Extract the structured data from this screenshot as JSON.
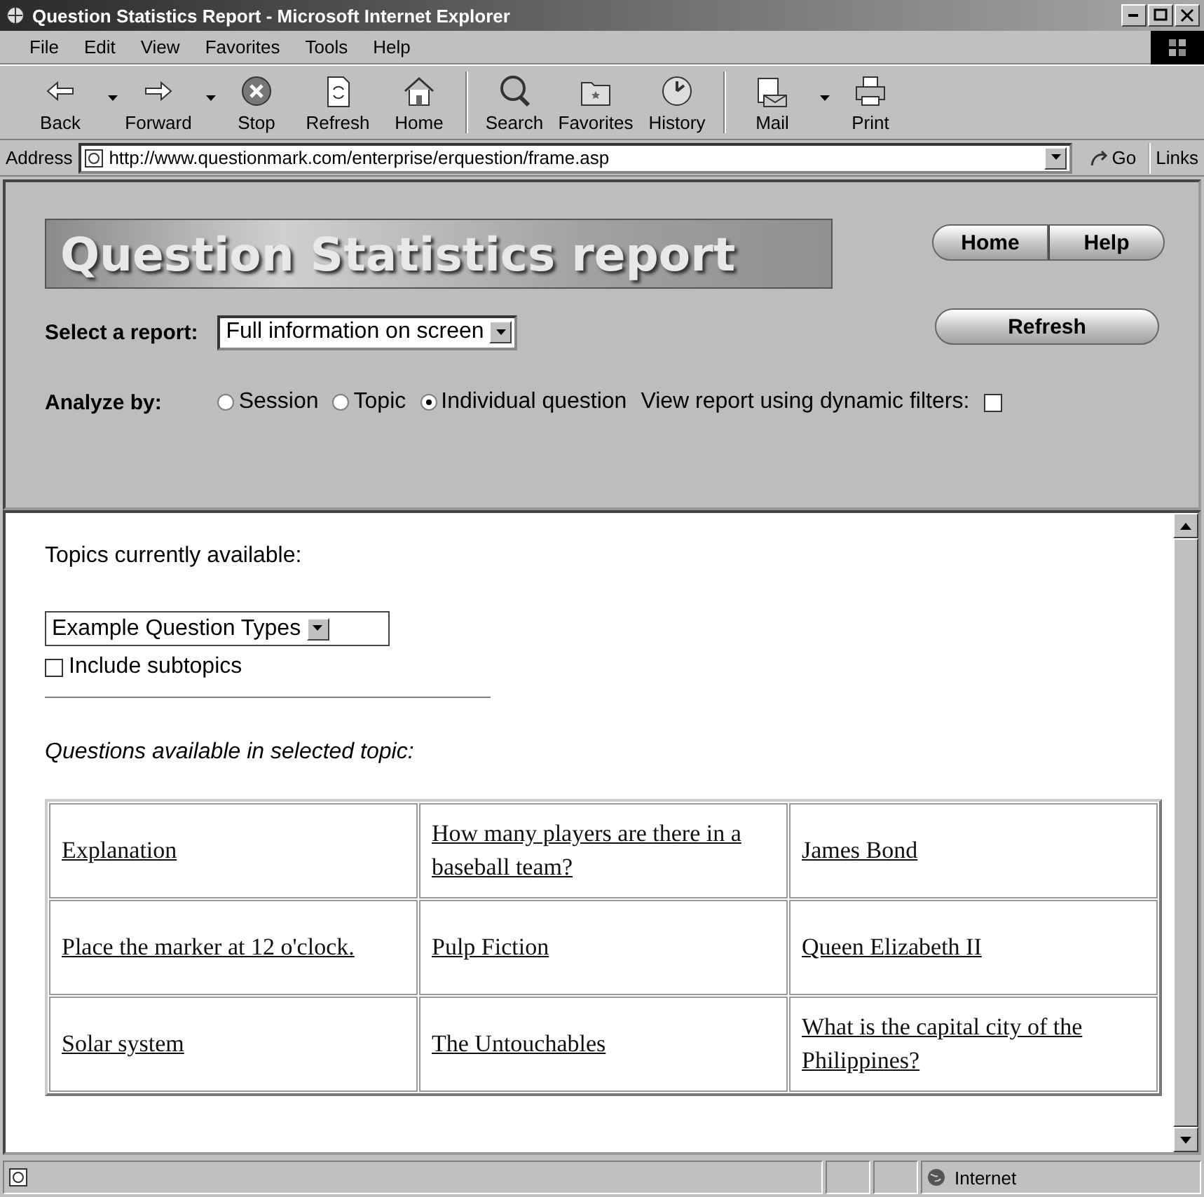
{
  "window": {
    "title": "Question Statistics Report - Microsoft Internet Explorer"
  },
  "menu": [
    "File",
    "Edit",
    "View",
    "Favorites",
    "Tools",
    "Help"
  ],
  "toolbar": [
    {
      "label": "Back",
      "kind": "back",
      "dropdown": true
    },
    {
      "label": "Forward",
      "kind": "forward",
      "dropdown": true
    },
    {
      "label": "Stop",
      "kind": "stop",
      "dropdown": false
    },
    {
      "label": "Refresh",
      "kind": "refresh",
      "dropdown": false
    },
    {
      "label": "Home",
      "kind": "home",
      "dropdown": false
    },
    {
      "label": "Search",
      "kind": "search",
      "dropdown": false
    },
    {
      "label": "Favorites",
      "kind": "favorites",
      "dropdown": false
    },
    {
      "label": "History",
      "kind": "history",
      "dropdown": false
    },
    {
      "label": "Mail",
      "kind": "mail",
      "dropdown": true
    },
    {
      "label": "Print",
      "kind": "print",
      "dropdown": false
    }
  ],
  "address_bar": {
    "label": "Address",
    "url": "http://www.questionmark.com/enterprise/erquestion/frame.asp",
    "go": "Go",
    "links": "Links"
  },
  "header": {
    "banner": "Question Statistics report",
    "nav_buttons": [
      "Home",
      "Help"
    ],
    "refresh_button": "Refresh",
    "report_label": "Select a report:",
    "report_value": "Full information on screen",
    "analyze_label": "Analyze by:",
    "analyze_options": [
      {
        "label": "Session",
        "selected": false
      },
      {
        "label": "Topic",
        "selected": false
      },
      {
        "label": "Individual question",
        "selected": true
      }
    ],
    "filters_label": "View report using dynamic filters:",
    "filters_checked": false
  },
  "content": {
    "topics_label": "Topics currently available:",
    "topic_value": "Example Question Types",
    "include_subtopics": {
      "label": "Include subtopics",
      "checked": false
    },
    "questions_heading": "Questions available in selected topic:",
    "questions": [
      [
        "Explanation",
        "How many players are there in a baseball team?",
        "James Bond"
      ],
      [
        "Place the marker at 12 o'clock.",
        "Pulp Fiction",
        "Queen Elizabeth II"
      ],
      [
        "Solar system",
        "The Untouchables",
        "What is the capital city of the Philippines?"
      ]
    ]
  },
  "status_bar": {
    "zone": "Internet"
  }
}
